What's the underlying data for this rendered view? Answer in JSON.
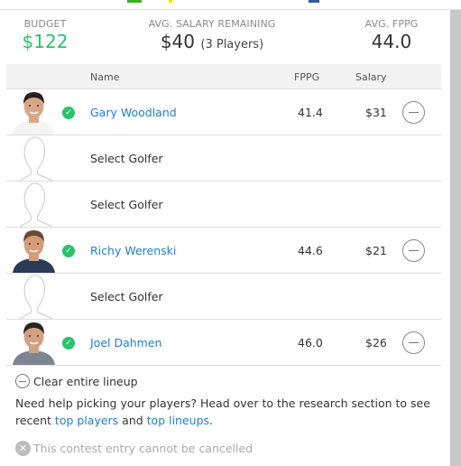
{
  "summary": {
    "budget_label": "BUDGET",
    "budget_value": "$122",
    "avg_salary_label": "AVG. SALARY REMAINING",
    "avg_salary_value": "$40",
    "avg_salary_sub": "(3 Players)",
    "avg_fppg_label": "AVG. FPPG",
    "avg_fppg_value": "44.0"
  },
  "colors": {
    "accent_green": "#28c36b",
    "link_blue": "#1a7fd6"
  },
  "table": {
    "headers": {
      "name": "Name",
      "fppg": "FPPG",
      "salary": "Salary"
    },
    "rows": [
      {
        "filled": true,
        "name": "Gary Woodland",
        "fppg": "41.4",
        "salary": "$31",
        "photo": "player-photo-skin-white-shirt"
      },
      {
        "filled": false,
        "name": "Select Golfer"
      },
      {
        "filled": false,
        "name": "Select Golfer"
      },
      {
        "filled": true,
        "name": "Richy Werenski",
        "fppg": "44.6",
        "salary": "$21",
        "photo": "player-photo-navy-shirt"
      },
      {
        "filled": false,
        "name": "Select Golfer"
      },
      {
        "filled": true,
        "name": "Joel Dahmen",
        "fppg": "46.0",
        "salary": "$26",
        "photo": "player-photo-gray-shirt"
      }
    ]
  },
  "footer": {
    "clear_label": "Clear entire lineup",
    "help_text_1": "Need help picking your players? Head over to the research section to see recent ",
    "help_link_1": "top players",
    "help_text_2": " and ",
    "help_link_2": "top lineups",
    "help_text_3": ".",
    "cancel_note": "This contest entry cannot be cancelled"
  },
  "icons": {
    "check": "✓",
    "cancel": "✕"
  }
}
